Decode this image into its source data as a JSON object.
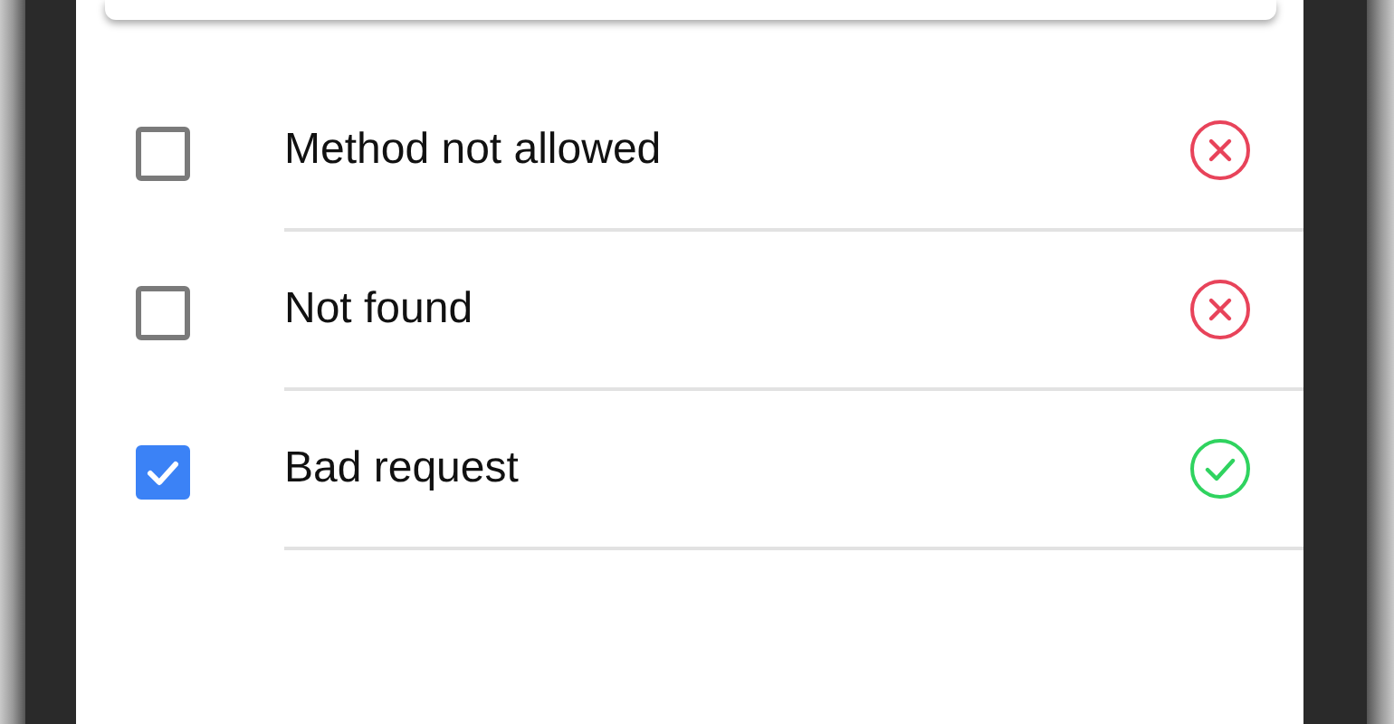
{
  "items": [
    {
      "label": "Method not allowed",
      "checked": false,
      "passed": false
    },
    {
      "label": "Not found",
      "checked": false,
      "passed": false
    },
    {
      "label": "Bad request",
      "checked": true,
      "passed": true
    }
  ]
}
